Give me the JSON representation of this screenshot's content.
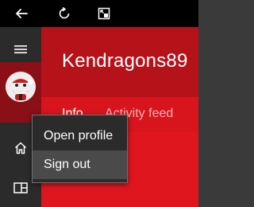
{
  "titlebar": {
    "back_icon": "back-arrow-icon",
    "refresh_icon": "refresh-icon",
    "overlay_icon": "compact-overlay-icon"
  },
  "rail": {
    "menu_icon": "hamburger-icon",
    "home_icon": "home-icon",
    "panel_icon": "panel-layout-icon",
    "avatar_icon": "santa-avatar-icon"
  },
  "profile": {
    "username": "Kendragons89"
  },
  "tabs": [
    {
      "label": "Info",
      "selected": true
    },
    {
      "label": "Activity feed",
      "selected": false
    }
  ],
  "context_menu": {
    "items": [
      {
        "label": "Open profile"
      },
      {
        "label": "Sign out"
      }
    ]
  },
  "colors": {
    "accent": "#e0161f",
    "header": "#b5121a",
    "rail": "#2b2b2b",
    "titlebar": "#000000"
  }
}
